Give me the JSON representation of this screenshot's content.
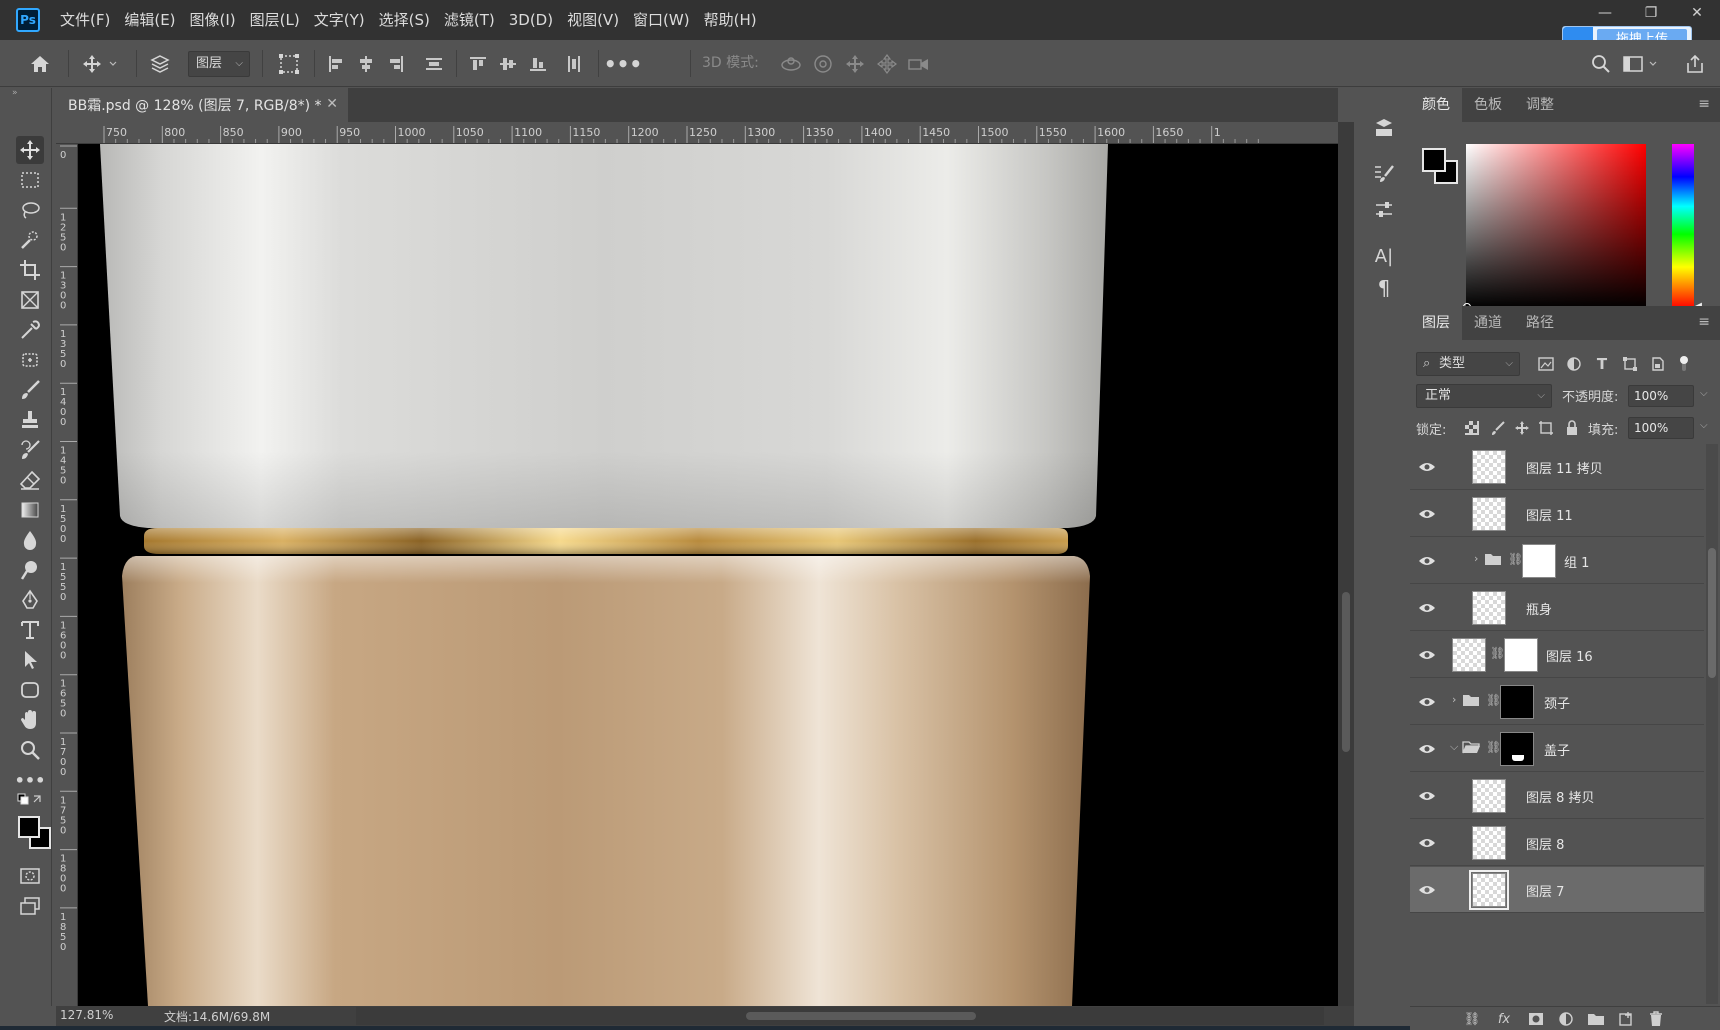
{
  "menu": {
    "app_logo": "Ps",
    "items": [
      "文件(F)",
      "编辑(E)",
      "图像(I)",
      "图层(L)",
      "文字(Y)",
      "选择(S)",
      "滤镜(T)",
      "3D(D)",
      "视图(V)",
      "窗口(W)",
      "帮助(H)"
    ],
    "upload_button": "拖拽上传"
  },
  "options_bar": {
    "layer_select": "图层",
    "mode_3d_label": "3D 模式:"
  },
  "document": {
    "tab_title": "BB霜.psd @ 128% (图层 7, RGB/8*) *",
    "zoom": "127.81%",
    "doc_size": "文档:14.6M/69.8M",
    "ruler_top_labels": [
      "750",
      "800",
      "850",
      "900",
      "950",
      "1000",
      "1050",
      "1100",
      "1150",
      "1200",
      "1250",
      "1300",
      "1350",
      "1400",
      "1450",
      "1500",
      "1550",
      "1600",
      "1650",
      "1"
    ],
    "ruler_left_labels": [
      "0",
      "1250",
      "1300",
      "1350",
      "1400",
      "1450",
      "1500",
      "1550",
      "1600",
      "1650",
      "1700",
      "1750",
      "1800",
      "1850"
    ]
  },
  "color_panel": {
    "tabs": [
      "颜色",
      "色板",
      "调整"
    ],
    "foreground": "#000000",
    "background": "#000000",
    "selected_hue": "#ff0000"
  },
  "layers_panel": {
    "tabs": [
      "图层",
      "通道",
      "路径"
    ],
    "filter_kind": "类型",
    "blend_mode": "正常",
    "opacity_label": "不透明度:",
    "opacity": "100%",
    "lock_label": "锁定:",
    "fill_label": "填充:",
    "fill": "100%",
    "layers": [
      {
        "name": "图层 11 拷贝",
        "type": "pixel",
        "indent": 1,
        "selected": false
      },
      {
        "name": "图层 11",
        "type": "pixel",
        "indent": 1,
        "selected": false
      },
      {
        "name": "组 1",
        "type": "group-collapsed",
        "indent": 1,
        "mask": true,
        "selected": false
      },
      {
        "name": "瓶身",
        "type": "pixel",
        "indent": 1,
        "selected": false
      },
      {
        "name": "图层 16",
        "type": "pixel-mask",
        "indent": 0,
        "selected": false
      },
      {
        "name": "颈子",
        "type": "group-collapsed",
        "indent": 0,
        "mask": true,
        "selected": false
      },
      {
        "name": "盖子",
        "type": "group-expanded",
        "indent": 0,
        "mask": true,
        "selected": false
      },
      {
        "name": "图层 8 拷贝",
        "type": "pixel",
        "indent": 1,
        "selected": false
      },
      {
        "name": "图层 8",
        "type": "pixel",
        "indent": 1,
        "selected": false
      },
      {
        "name": "图层 7",
        "type": "pixel",
        "indent": 1,
        "selected": true
      }
    ]
  },
  "colors": {
    "app_bg": "#535353",
    "menubar_bg": "#323232",
    "cap_silver": "#d4d4d2",
    "gold_ring": "#c9a050",
    "bottle_beige": "#c9aa86",
    "accent_blue": "#31a8ff"
  }
}
